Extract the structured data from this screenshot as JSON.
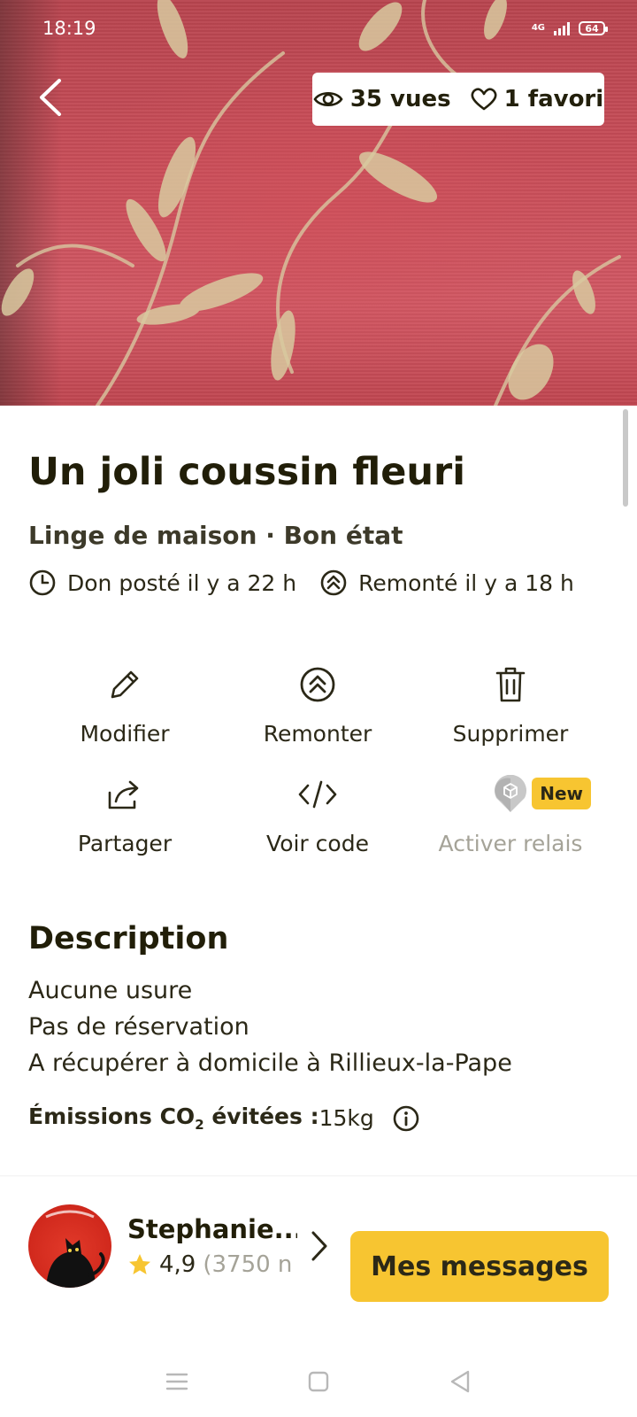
{
  "status_bar": {
    "time": "18:19",
    "network": "4G",
    "battery": "64"
  },
  "listing": {
    "stats": {
      "views": "35 vues",
      "favorites": "1 favori"
    },
    "title": "Un joli coussin fleuri",
    "subtitle": "Linge de maison · Bon état",
    "posted": "Don posté il y a 22 h",
    "bumped": "Remonté il y a 18 h"
  },
  "actions": [
    {
      "label": "Modifier",
      "icon": "pencil-icon",
      "enabled": true
    },
    {
      "label": "Remonter",
      "icon": "double-chevron-up-icon",
      "enabled": true
    },
    {
      "label": "Supprimer",
      "icon": "trash-icon",
      "enabled": true
    },
    {
      "label": "Partager",
      "icon": "share-icon",
      "enabled": true
    },
    {
      "label": "Voir code",
      "icon": "code-icon",
      "enabled": true
    },
    {
      "label": "Activer relais",
      "icon": "relay-box-icon",
      "enabled": false,
      "badge": "New"
    }
  ],
  "description": {
    "heading": "Description",
    "lines": [
      "Aucune usure",
      "Pas de réservation",
      "A récupérer à domicile à Rillieux-la-Pape"
    ],
    "co2_label_prefix": "Émissions CO",
    "co2_subscript": "2",
    "co2_label_suffix": " évitées :",
    "co2_value": " 15kg"
  },
  "user": {
    "name": "Stephanie...",
    "rating": "4,9",
    "reviews": "(3750 n"
  },
  "cta": {
    "messages_label": "Mes messages"
  },
  "colors": {
    "accent": "#f7c531",
    "text": "#23200c",
    "muted": "#a5a398",
    "hero": "#c84d58"
  }
}
